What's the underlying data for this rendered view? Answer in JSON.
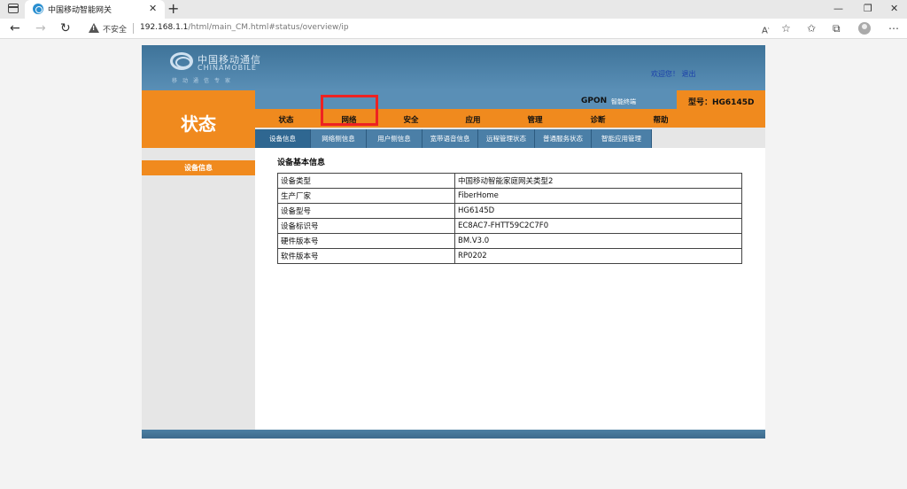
{
  "browser": {
    "tab_title": "中国移动智能网关",
    "tab_close": "✕",
    "new_tab": "+",
    "insecure_label": "不安全",
    "url_host": "192.168.1.1",
    "url_path": "/html/main_CM.html#status/overview/ip",
    "minimize": "—",
    "maximize": "❐",
    "close": "✕"
  },
  "banner": {
    "logo_cn": "中国移动通信",
    "logo_en": "CHINAMOBILE",
    "logo_sub": "移动通信专家",
    "welcome": "欢迎您！ 退出"
  },
  "status_title": "状态",
  "gpon": {
    "label": "GPON",
    "sub": "智能终端",
    "model": "型号：HG6145D"
  },
  "menu": [
    "状态",
    "网络",
    "安全",
    "应用",
    "管理",
    "诊断",
    "帮助"
  ],
  "submenu": [
    "设备信息",
    "网络侧信息",
    "用户侧信息",
    "宽带语音信息",
    "远程管理状态",
    "普通服务状态",
    "智能应用管理"
  ],
  "sidebar": {
    "items": [
      "设备信息"
    ]
  },
  "content": {
    "section_title": "设备基本信息",
    "rows": [
      {
        "label": "设备类型",
        "value": "中国移动智能家庭网关类型2"
      },
      {
        "label": "生产厂家",
        "value": "FiberHome"
      },
      {
        "label": "设备型号",
        "value": "HG6145D"
      },
      {
        "label": "设备标识号",
        "value": "EC8AC7-FHTT59C2C7F0"
      },
      {
        "label": "硬件版本号",
        "value": "BM.V3.0"
      },
      {
        "label": "软件版本号",
        "value": "RP0202"
      }
    ]
  },
  "colors": {
    "orange": "#f08a1e",
    "blue": "#4b7fa7",
    "highlight": "#ee2222"
  }
}
